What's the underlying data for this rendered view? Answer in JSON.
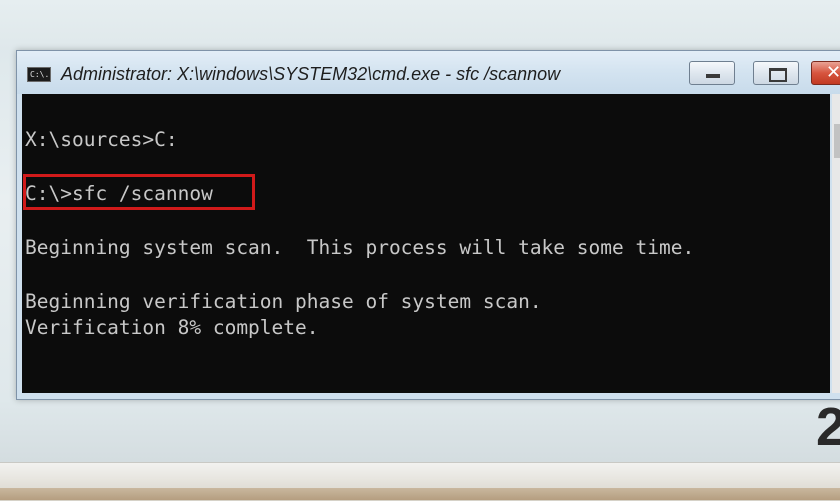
{
  "window": {
    "title": "Administrator: X:\\windows\\SYSTEM32\\cmd.exe - sfc  /scannow",
    "icon": "cmd-icon",
    "icon_label": "C:\\.",
    "controls": [
      "minimize",
      "maximize",
      "close"
    ],
    "close_glyph": "✕"
  },
  "console": {
    "lines": [
      "X:\\sources>C:",
      "C:\\>sfc /scannow",
      "Beginning system scan.  This process will take some time.",
      "Beginning verification phase of system scan.",
      "Verification 8% complete."
    ],
    "highlighted_line": "C:\\>sfc /scannow",
    "highlight_color": "#d11a1a",
    "text_color": "#c8c8c8",
    "background_color": "#0c0c0c"
  },
  "background": {
    "corner_digit": "2"
  }
}
